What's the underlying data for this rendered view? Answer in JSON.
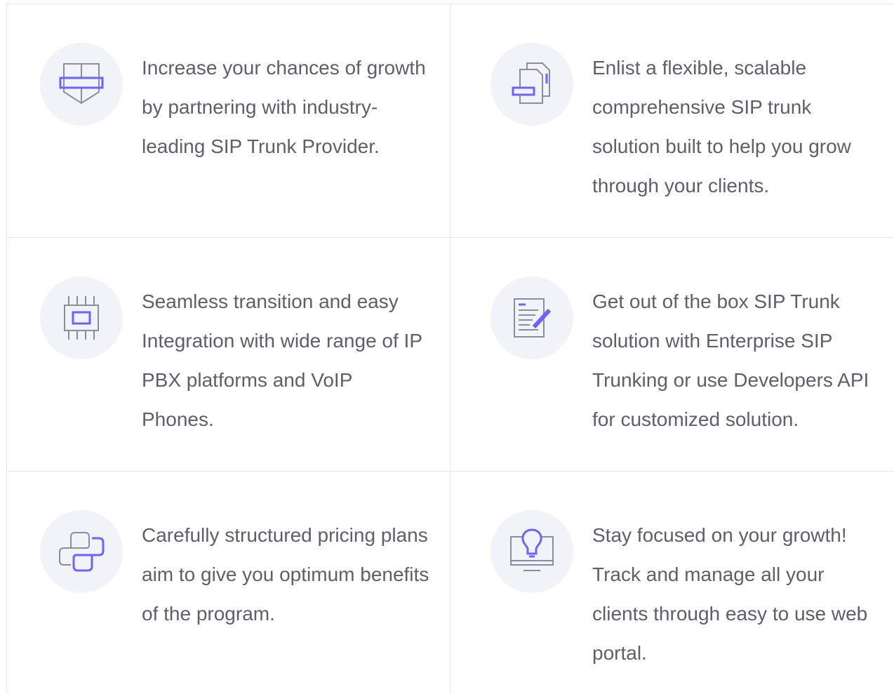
{
  "features": [
    {
      "icon": "shield-icon",
      "text": "Increase your chances of growth by partnering with industry-leading SIP Trunk Provider."
    },
    {
      "icon": "documents-icon",
      "text": "Enlist a flexible, scalable comprehensive SIP trunk solution built to help you grow through your clients."
    },
    {
      "icon": "chip-icon",
      "text": "Seamless transition and easy Integration with wide range of IP PBX platforms and VoIP Phones."
    },
    {
      "icon": "document-edit-icon",
      "text": "Get out of the box SIP Trunk solution with Enterprise SIP Trunking or use Developers API for customized solution."
    },
    {
      "icon": "python-icon",
      "text": "Carefully structured pricing plans aim to give you optimum benefits of the program."
    },
    {
      "icon": "monitor-lightbulb-icon",
      "text": "Stay focused on your growth! Track and manage all your clients through easy to use web portal."
    }
  ],
  "colors": {
    "accent": "#6c63ff",
    "icon_stroke": "#8a8d9c",
    "icon_bg": "#f2f3f8",
    "text": "#5d5f6e",
    "border": "#e4e6f0"
  }
}
